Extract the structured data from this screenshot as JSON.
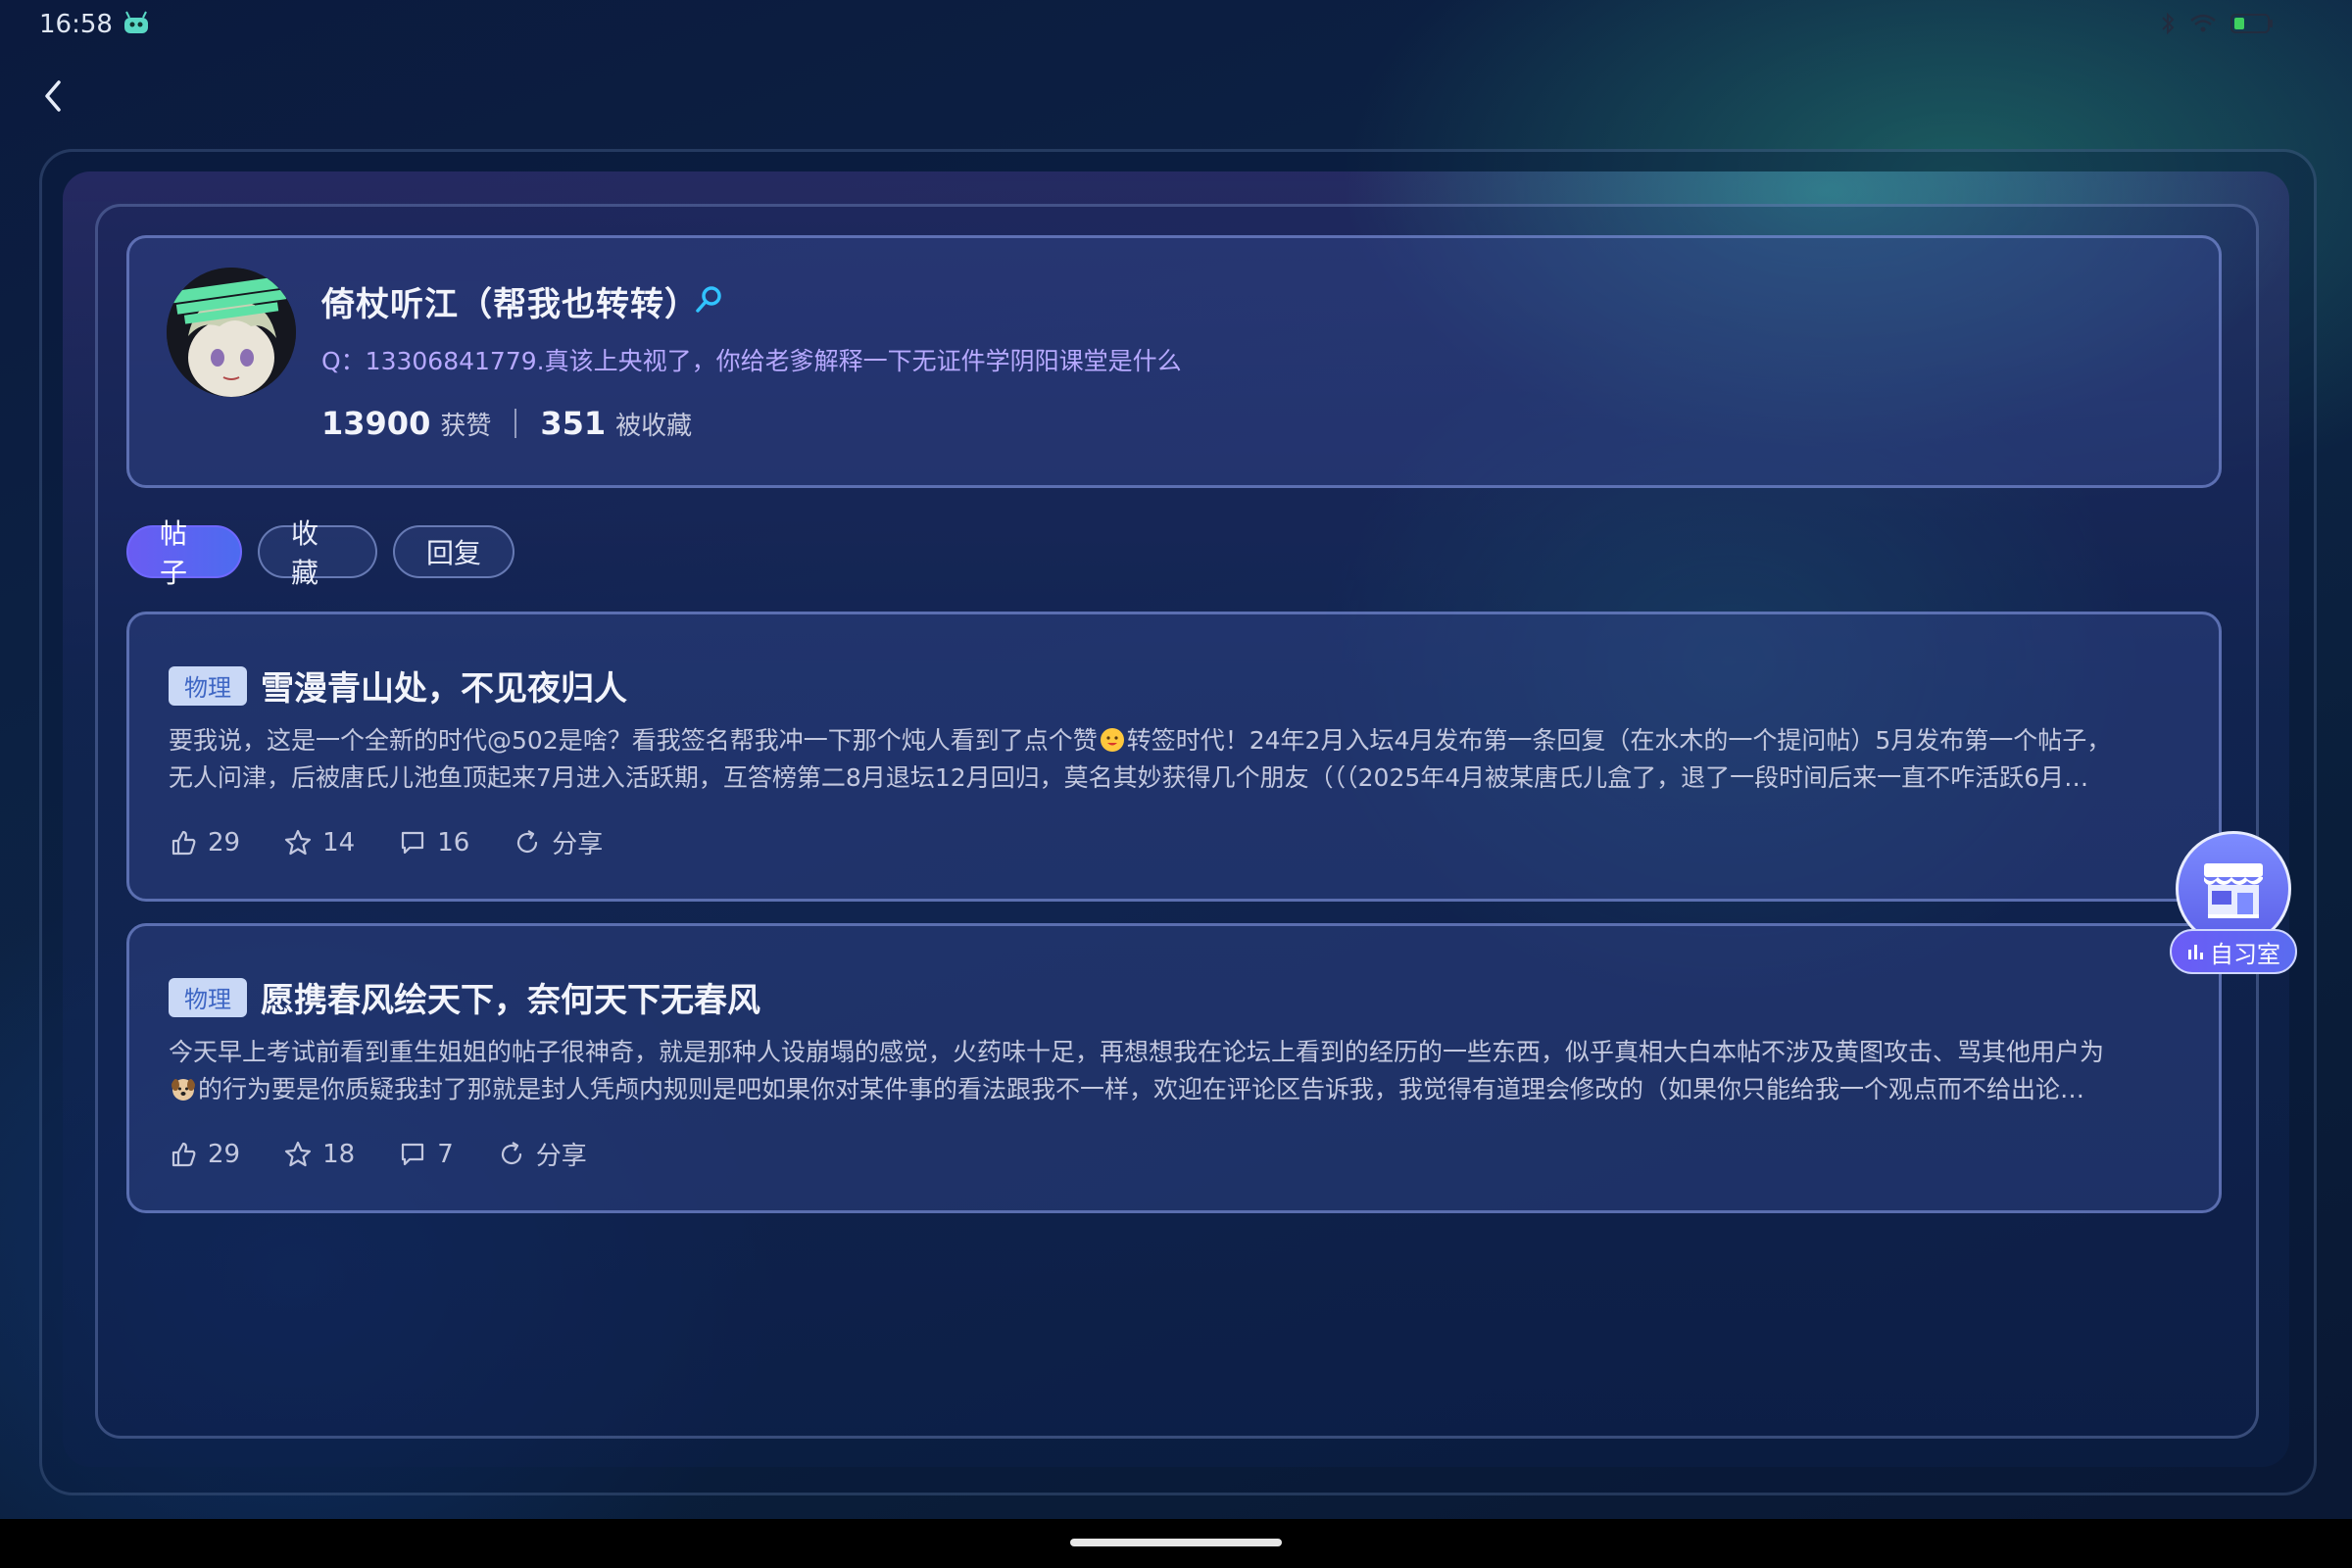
{
  "status_bar": {
    "time": "16:58",
    "icons": [
      "android-robot-icon",
      "bluetooth-icon",
      "wifi-icon",
      "battery-icon"
    ]
  },
  "navigation": {
    "back_icon": "chevron-left-icon"
  },
  "profile": {
    "nickname": "倚杖听江（帮我也转转）",
    "gender_icon": "female-icon",
    "signature": "Q：13306841779.真该上央视了，你给老爹解释一下无证件学阴阳课堂是什么",
    "likes_count": "13900",
    "likes_label": "获赞",
    "favorited_count": "351",
    "favorited_label": "被收藏"
  },
  "tabs": [
    {
      "label": "帖子",
      "active": true
    },
    {
      "label": "收藏",
      "active": false
    },
    {
      "label": "回复",
      "active": false
    }
  ],
  "posts": [
    {
      "tag": "物理",
      "title": "雪漫青山处，不见夜归人",
      "body_line1_a": "要我说，这是一个全新的时代@502是啥？看我签名帮我冲一下那个炖人看到了点个赞",
      "body_line1_b": "转签时代！24年2月入坛4月发布第一条回复（在水木的一个提问帖）5月发布第一个帖子，",
      "body_line2": "无人问津，后被唐氏儿池鱼顶起来7月进入活跃期，互答榜第二8月退坛12月回归，莫名其妙获得几个朋友（（（2025年4月被某唐氏儿盒了，退了一段时间后来一直不咋活跃6月…",
      "likes": "29",
      "stars": "14",
      "comments": "16",
      "share_label": "分享"
    },
    {
      "tag": "物理",
      "title": "愿携春风绘天下，奈何天下无春风",
      "body_line1": "今天早上考试前看到重生姐姐的帖子很神奇，就是那种人设崩塌的感觉，火药味十足，再想想我在论坛上看到的经历的一些东西，似乎真相大白本帖不涉及黄图攻击、骂其他用户为",
      "body_line2": "的行为要是你质疑我封了那就是封人凭颅内规则是吧如果你对某件事的看法跟我不一样，欢迎在评论区告诉我，我觉得有道理会修改的（如果你只能给我一个观点而不给出论…",
      "likes": "29",
      "stars": "18",
      "comments": "7",
      "share_label": "分享"
    }
  ],
  "floating_button": {
    "label": "自习室",
    "icon": "store-icon"
  },
  "colors": {
    "accent": "#6a5cf2",
    "signature": "#b7a9ff",
    "tag_bg": "#c9d8f6",
    "tag_text": "#3e66c4"
  }
}
